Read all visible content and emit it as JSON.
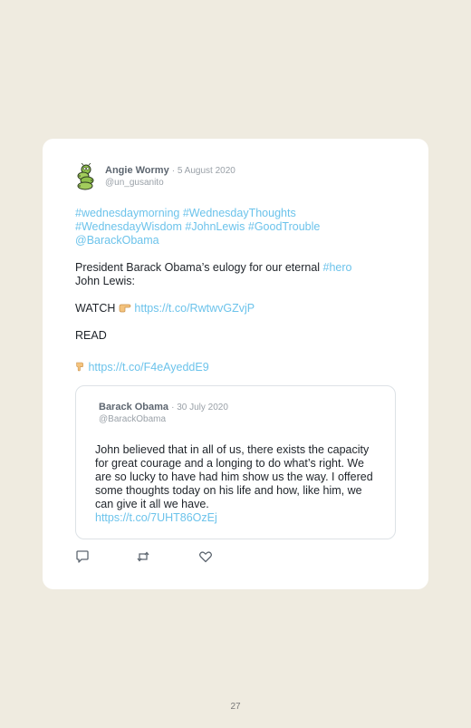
{
  "tweet": {
    "author": {
      "name": "Angie Wormy",
      "date": "· 5 August 2020",
      "handle": "@un_gusanito",
      "avatar_icon": "worm-avatar"
    },
    "hashtags": {
      "tag1": "#wednesdaymorning",
      "tag2": "#WednesdayThoughts",
      "tag3": "#WednesdayWisdom",
      "tag4": "#JohnLewis",
      "tag5": "#GoodTrouble",
      "mention": "@BarackObama"
    },
    "eulogy": {
      "text": "President Barack Obama’s eulogy for our eternal ",
      "tag": "#hero",
      "text2": "John Lewis:"
    },
    "watch": {
      "label": "WATCH",
      "emoji": "pointing-right-hand-icon",
      "link": "https://t.co/RwtwvGZvjP"
    },
    "read": {
      "label": "READ",
      "emoji": "pointing-down-hand-icon",
      "link": "https://t.co/F4eAyeddE9"
    }
  },
  "quoted_tweet": {
    "name": "Barack Obama",
    "date": "· 30 July 2020",
    "handle": "@BarackObama",
    "text": "John believed that in all of us, there exists the capacity for great courage and a longing to do what’s right. We are so lucky to have had him show us the way. I offered some thoughts today on his life and how, like him, we can give it all we have.",
    "link": "https://t.co/7UHT86OzEj"
  },
  "actions": [
    "reply-icon",
    "retweet-icon",
    "like-icon"
  ],
  "colors": {
    "page_background": "#efebe0",
    "card_background": "#ffffff",
    "link": "#6cc3eb",
    "muted_text": "#9aa1a8"
  },
  "page_number": "27"
}
